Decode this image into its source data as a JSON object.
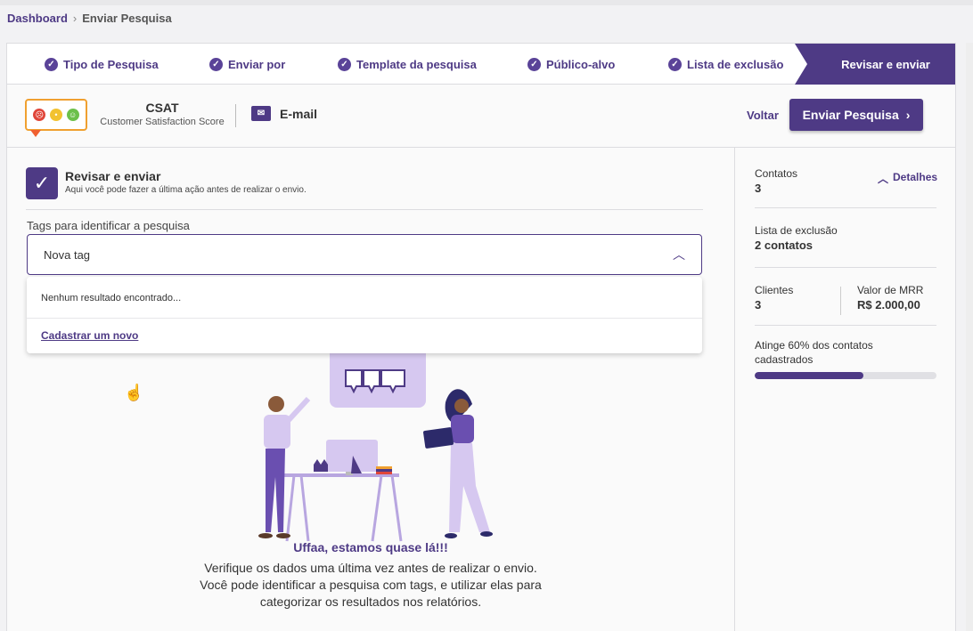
{
  "breadcrumb": {
    "home": "Dashboard",
    "separator": "›",
    "current": "Enviar Pesquisa"
  },
  "stepper": {
    "steps": [
      {
        "label": "Tipo de Pesquisa"
      },
      {
        "label": "Enviar por"
      },
      {
        "label": "Template da pesquisa"
      },
      {
        "label": "Público-alvo"
      },
      {
        "label": "Lista de exclusão"
      }
    ],
    "active": "Revisar e enviar"
  },
  "header": {
    "survey_type": "CSAT",
    "survey_type_full": "Customer Satisfaction Score",
    "channel": "E-mail",
    "back_label": "Voltar",
    "send_label": "Enviar Pesquisa"
  },
  "review": {
    "title": "Revisar e enviar",
    "subtitle": "Aqui você pode fazer a última ação antes de realizar o envio.",
    "tags_label": "Tags para identificar a pesquisa",
    "tags_input_value": "Nova tag",
    "dropdown": {
      "no_results": "Nenhum resultado encontrado...",
      "create_new": "Cadastrar um novo"
    },
    "message_title": "Uffaa, estamos quase lá!!!",
    "message_line1": "Verifique os dados uma última vez antes de realizar o envio.",
    "message_line2": "Você pode identificar a pesquisa com tags, e utilizar elas para",
    "message_line3": "categorizar os resultados nos relatórios."
  },
  "summary": {
    "details_label": "Detalhes",
    "contacts_label": "Contatos",
    "contacts_value": "3",
    "exclusion_label": "Lista de exclusão",
    "exclusion_value": "2 contatos",
    "clients_label": "Clientes",
    "clients_value": "3",
    "mrr_label": "Valor de MRR",
    "mrr_value": "R$ 2.000,00",
    "reach_label": "Atinge 60% dos contatos cadastrados",
    "reach_fraction": 0.6
  },
  "colors": {
    "primary": "#4e3a85",
    "accent_light": "#d6c8f0"
  }
}
